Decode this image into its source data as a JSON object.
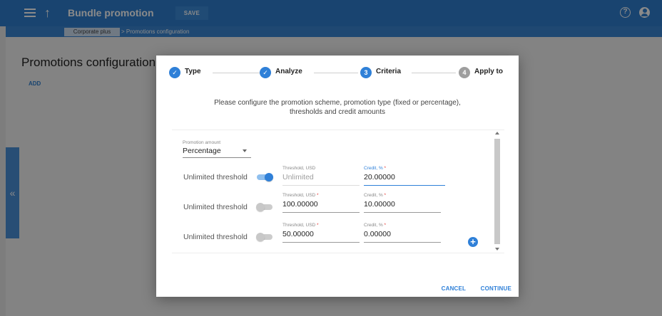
{
  "app_bar": {
    "title": "Bundle promotion",
    "save_label": "SAVE",
    "help_symbol": "?",
    "up_symbol": "↑",
    "icons": [
      "menu-icon",
      "arrow-up-icon",
      "help-icon",
      "account-icon"
    ]
  },
  "breadcrumb": {
    "items": [
      "Corporate plus",
      "> Promotions configuration"
    ]
  },
  "page": {
    "title": "Promotions configuration",
    "add_label": "ADD",
    "side_handle_symbol": "«"
  },
  "dialog": {
    "steps": [
      {
        "number": "✓",
        "label": "Type",
        "status": "done"
      },
      {
        "number": "✓",
        "label": "Analyze",
        "status": "done"
      },
      {
        "number": "3",
        "label": "Criteria",
        "status": "active"
      },
      {
        "number": "4",
        "label": "Apply to",
        "status": "todo"
      }
    ],
    "intro_line1": "Please configure the promotion scheme, promotion type (fixed or percentage),",
    "intro_line2": "thresholds and credit amounts",
    "promotion_amount": {
      "label": "Promotion amount",
      "value": "Percentage"
    },
    "rows": [
      {
        "unlimited_label": "Unlimited threshold",
        "unlimited_on": true,
        "threshold_label": "Threshold, USD",
        "threshold_required": false,
        "threshold_value": "Unlimited",
        "credit_label": "Credit, % ",
        "credit_value": "20.00000"
      },
      {
        "unlimited_label": "Unlimited threshold",
        "unlimited_on": false,
        "threshold_label": "Threshold, USD ",
        "threshold_required": true,
        "threshold_value": "100.00000",
        "credit_label": "Credit, % ",
        "credit_value": "10.00000"
      },
      {
        "unlimited_label": "Unlimited threshold",
        "unlimited_on": false,
        "threshold_label": "Threshold, USD ",
        "threshold_required": true,
        "threshold_value": "50.00000",
        "credit_label": "Credit, % ",
        "credit_value": "0.00000"
      }
    ],
    "required_mark": "*",
    "add_row_symbol": "+",
    "cancel_label": "CANCEL",
    "continue_label": "CONTINUE"
  },
  "colors": {
    "primary": "#2f80d8",
    "app_bar": "#2f7fcf",
    "required": "#e53935"
  }
}
